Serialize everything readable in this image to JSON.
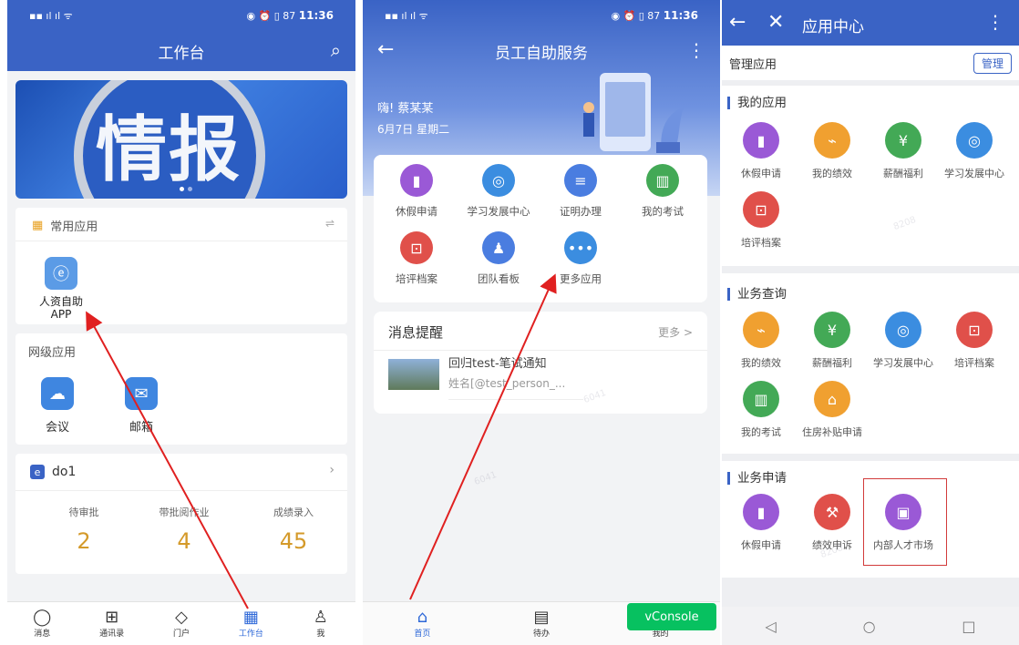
{
  "phone1": {
    "status_time": "11:36",
    "status_battery": "87",
    "title": "工作台",
    "banner_text": "情报",
    "frequent": {
      "title": "常用应用",
      "apps": [
        {
          "label": "人资自助APP"
        }
      ]
    },
    "network": {
      "title": "网级应用",
      "apps": [
        {
          "label": "会议"
        },
        {
          "label": "邮箱"
        }
      ]
    },
    "do1": {
      "title": "do1",
      "stats": [
        {
          "label": "待审批",
          "value": "2"
        },
        {
          "label": "带批阅作业",
          "value": "4"
        },
        {
          "label": "成绩录入",
          "value": "45"
        }
      ]
    },
    "tabs": [
      {
        "label": "消息"
      },
      {
        "label": "通讯录"
      },
      {
        "label": "门户"
      },
      {
        "label": "工作台"
      },
      {
        "label": "我"
      }
    ]
  },
  "phone2": {
    "status_time": "11:36",
    "status_battery": "87",
    "title": "员工自助服务",
    "greeting": "嗨! 蔡某某",
    "date": "6月7日 星期二",
    "apps": [
      {
        "label": "休假申请",
        "color": "#9a59d6"
      },
      {
        "label": "学习发展中心",
        "color": "#3b8de0"
      },
      {
        "label": "证明办理",
        "color": "#4a7de0"
      },
      {
        "label": "我的考试",
        "color": "#43a956"
      },
      {
        "label": "培评档案",
        "color": "#e0504a"
      },
      {
        "label": "团队看板",
        "color": "#4a7de0"
      },
      {
        "label": "更多应用",
        "color": "#3b8de0"
      }
    ],
    "messages": {
      "title": "消息提醒",
      "more": "更多 >",
      "item_title": "回归test-笔试通知",
      "item_sub": "姓名[@test_person_..."
    },
    "vconsole": "vConsole",
    "tabs": [
      {
        "label": "首页"
      },
      {
        "label": "待办"
      },
      {
        "label": "我的"
      }
    ]
  },
  "phone3": {
    "title": "应用中心",
    "manage_label": "管理应用",
    "manage_button": "管理",
    "my_apps": {
      "title": "我的应用",
      "items": [
        {
          "label": "休假申请",
          "color": "#9a59d6"
        },
        {
          "label": "我的绩效",
          "color": "#f0a030"
        },
        {
          "label": "薪酬福利",
          "color": "#43a956"
        },
        {
          "label": "学习发展中心",
          "color": "#3b8de0"
        },
        {
          "label": "培评档案",
          "color": "#e0504a"
        }
      ]
    },
    "query": {
      "title": "业务查询",
      "items": [
        {
          "label": "我的绩效",
          "color": "#f0a030"
        },
        {
          "label": "薪酬福利",
          "color": "#43a956"
        },
        {
          "label": "学习发展中心",
          "color": "#3b8de0"
        },
        {
          "label": "培评档案",
          "color": "#e0504a"
        },
        {
          "label": "我的考试",
          "color": "#43a956"
        },
        {
          "label": "住房补贴申请",
          "color": "#f0a030"
        }
      ]
    },
    "apply": {
      "title": "业务申请",
      "items": [
        {
          "label": "休假申请",
          "color": "#9a59d6"
        },
        {
          "label": "绩效申诉",
          "color": "#e0504a"
        },
        {
          "label": "内部人才市场",
          "color": "#9a59d6"
        }
      ]
    }
  },
  "accent": "#3a63c5"
}
